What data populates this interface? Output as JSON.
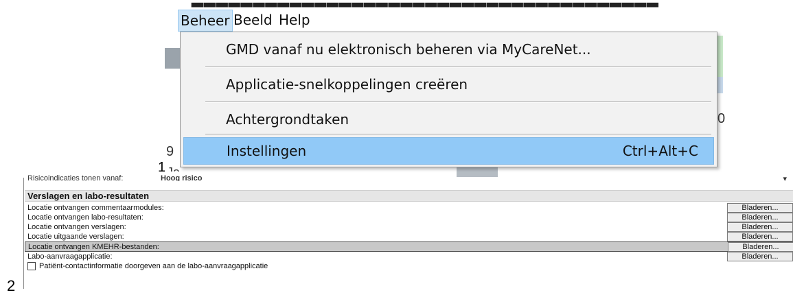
{
  "menubar": {
    "items": [
      {
        "label": "Beheer"
      },
      {
        "label": "Beeld"
      },
      {
        "label": "Help"
      }
    ]
  },
  "dropdown": {
    "items": [
      {
        "label": "GMD vanaf nu elektronisch beheren via MyCareNet...",
        "shortcut": ""
      },
      {
        "label": "Applicatie-snelkoppelingen creëren",
        "shortcut": ""
      },
      {
        "label": "Achtergrondtaken",
        "shortcut": ""
      },
      {
        "label": "Instellingen",
        "shortcut": "Ctrl+Alt+C"
      }
    ],
    "highlight_color": "#91c9f7"
  },
  "markers": {
    "one": "1",
    "two": "2"
  },
  "partial_text": {
    "left_9": "9",
    "right_0": "0",
    "below_ja": "Ja"
  },
  "settings": {
    "cut_row": {
      "label": "Risicoindicaties tonen vanaf:",
      "value": "Hoog risico",
      "arrow": "▾"
    },
    "section_title": "Verslagen en labo-resultaten",
    "rows": [
      {
        "label": "Locatie ontvangen commentaarmodules:",
        "button": "Bladeren..."
      },
      {
        "label": "Locatie ontvangen labo-resultaten:",
        "button": "Bladeren..."
      },
      {
        "label": "Locatie ontvangen verslagen:",
        "button": "Bladeren..."
      },
      {
        "label": "Locatie uitgaande verslagen:",
        "button": "Bladeren..."
      },
      {
        "label": "Locatie ontvangen KMEHR-bestanden:",
        "button": "Bladeren..."
      },
      {
        "label": "Labo-aanvraagapplicatie:",
        "button": "Bladeren..."
      }
    ],
    "checkbox_label": "Patiënt-contactinformatie doorgeven aan de labo-aanvraagapplicatie"
  }
}
